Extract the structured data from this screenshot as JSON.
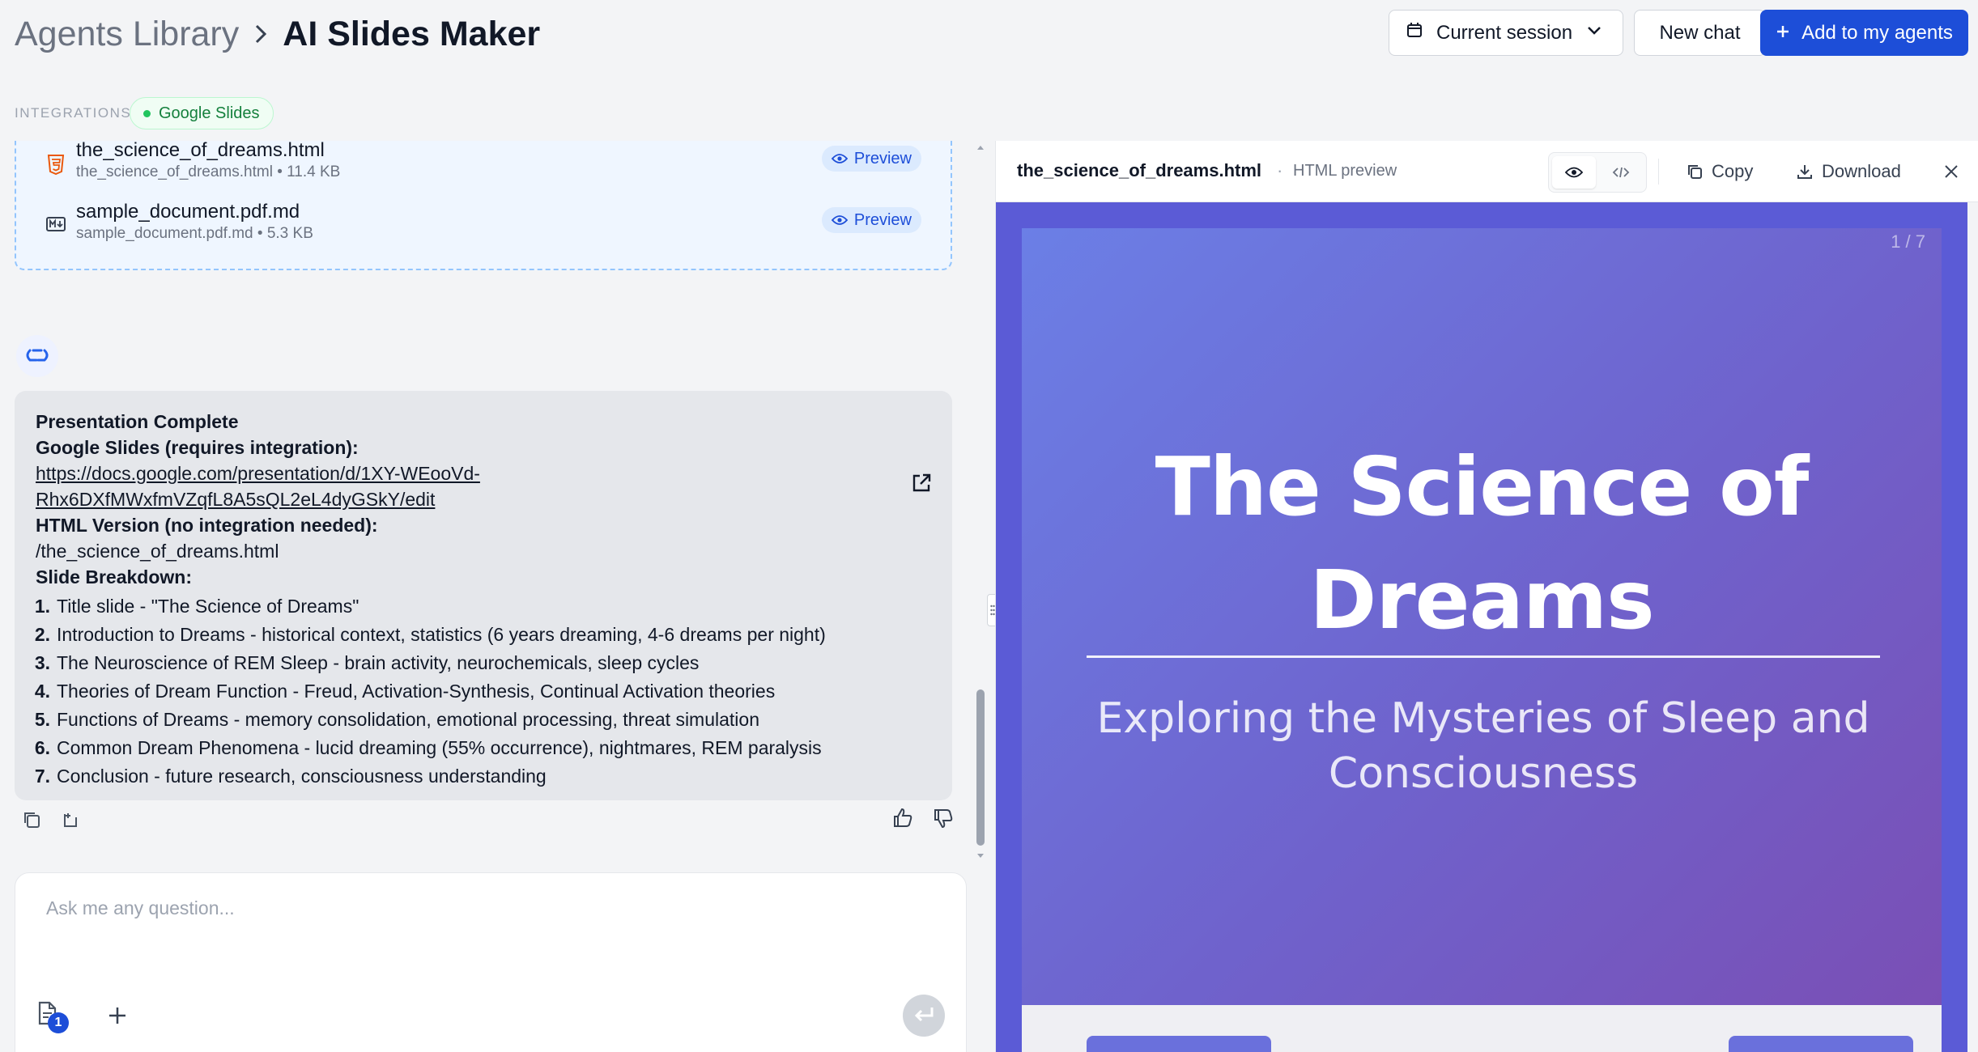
{
  "header": {
    "breadcrumb_parent": "Agents Library",
    "breadcrumb_current": "AI Slides Maker",
    "session_label": "Current session",
    "new_chat_label": "New chat",
    "add_agents_label": "Add to my agents"
  },
  "integrations": {
    "label": "INTEGRATIONS",
    "items": [
      {
        "label": "Google Slides",
        "status_color": "#22c55e"
      }
    ]
  },
  "files": [
    {
      "name": "the_science_of_dreams.html",
      "meta": "the_science_of_dreams.html • 11.4 KB",
      "icon": "html5-icon",
      "action": "Preview"
    },
    {
      "name": "sample_document.pdf.md",
      "meta": "sample_document.pdf.md • 5.3 KB",
      "icon": "markdown-icon",
      "action": "Preview"
    }
  ],
  "message": {
    "heading": "Presentation Complete",
    "gslides_label": "Google Slides (requires integration):",
    "gslides_url_line1": "https://docs.google.com/presentation/d/1XY-WEooVd-",
    "gslides_url_line2": "Rhx6DXfMWxfmVZqfL8A5sQL2eL4dyGSkY/edit",
    "html_label": "HTML Version (no integration needed):",
    "html_path": "/the_science_of_dreams.html",
    "breakdown_label": "Slide Breakdown:",
    "slides": [
      {
        "num": "1.",
        "text": "Title slide - \"The Science of Dreams\""
      },
      {
        "num": "2.",
        "text": "Introduction to Dreams - historical context, statistics (6 years dreaming, 4-6 dreams per night)"
      },
      {
        "num": "3.",
        "text": "The Neuroscience of REM Sleep - brain activity, neurochemicals, sleep cycles"
      },
      {
        "num": "4.",
        "text": "Theories of Dream Function - Freud, Activation-Synthesis, Continual Activation theories"
      },
      {
        "num": "5.",
        "text": "Functions of Dreams - memory consolidation, emotional processing, threat simulation"
      },
      {
        "num": "6.",
        "text": "Common Dream Phenomena - lucid dreaming (55% occurrence), nightmares, REM paralysis"
      },
      {
        "num": "7.",
        "text": "Conclusion - future research, consciousness understanding"
      }
    ]
  },
  "input": {
    "placeholder": "Ask me any question...",
    "attachment_count": "1"
  },
  "preview_panel": {
    "filename": "the_science_of_dreams.html",
    "separator": "·",
    "subtitle": "HTML preview",
    "copy_label": "Copy",
    "download_label": "Download",
    "slide_counter": "1 / 7",
    "slide_title": "The Science of Dreams",
    "slide_subtitle": "Exploring the Mysteries of Sleep and Consciousness"
  },
  "colors": {
    "accent": "#1d4ed8",
    "slide_gradient_start": "#6b7fe6",
    "slide_gradient_end": "#7a4fb5"
  }
}
